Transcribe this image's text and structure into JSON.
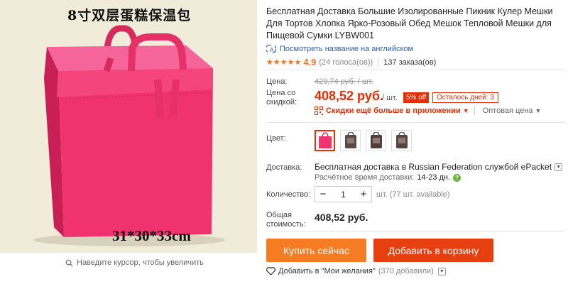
{
  "image": {
    "caption_top": "8寸双层蛋糕保温包",
    "caption_bottom": "31*30*33cm",
    "zoom_hint": "Наведите курсор, чтобы увеличить",
    "bag_color": "#f0326e"
  },
  "product": {
    "title": "Бесплатная Доставка Большие Изолированные Пикник Кулер Мешки Для Тортов Хлопка Ярко-Розовый Обед Мешок Тепловой Мешки для Пищевой Сумки LYBW001",
    "translate_link": "Посмотреть название на английском",
    "rating_value": "4.9",
    "votes": "(24 голоса(ов))",
    "orders": "137 заказа(ов)"
  },
  "price": {
    "label": "Цена:",
    "old": "429,74 руб. / шт.",
    "sale_label": "Цена со скидкой:",
    "new": "408,52 руб.",
    "per_unit": "/ шт.",
    "discount": "5% off",
    "days_left": "Осталось дней: 3",
    "app_discount": "Скидки ещё больше в приложении",
    "wholesale": "Оптовая цена"
  },
  "color": {
    "label": "Цвет:",
    "accent": "#e62e04"
  },
  "shipping": {
    "label": "Доставка:",
    "line": "Бесплатная доставка в Russian Federation службой ePacket",
    "eta_label": "Расчётное время доставки:",
    "eta_days": "14-23 дн."
  },
  "quantity": {
    "label": "Количество:",
    "minus": "−",
    "value": "1",
    "plus": "+",
    "note": "шт. (77 шт. available)"
  },
  "total": {
    "label": "Общая стоимость:",
    "value": "408,52 руб."
  },
  "actions": {
    "buy_now": "Купить сейчас",
    "add_to_cart": "Добавить в корзину",
    "wishlist": "Добавить в \"Мои желания\"",
    "wishlist_count": "(370 добавили)"
  },
  "icons": {
    "translate": "translate-icon",
    "qr": "qr-code-icon",
    "zoom": "magnifier-icon",
    "heart": "heart-icon",
    "help": "help-icon"
  }
}
